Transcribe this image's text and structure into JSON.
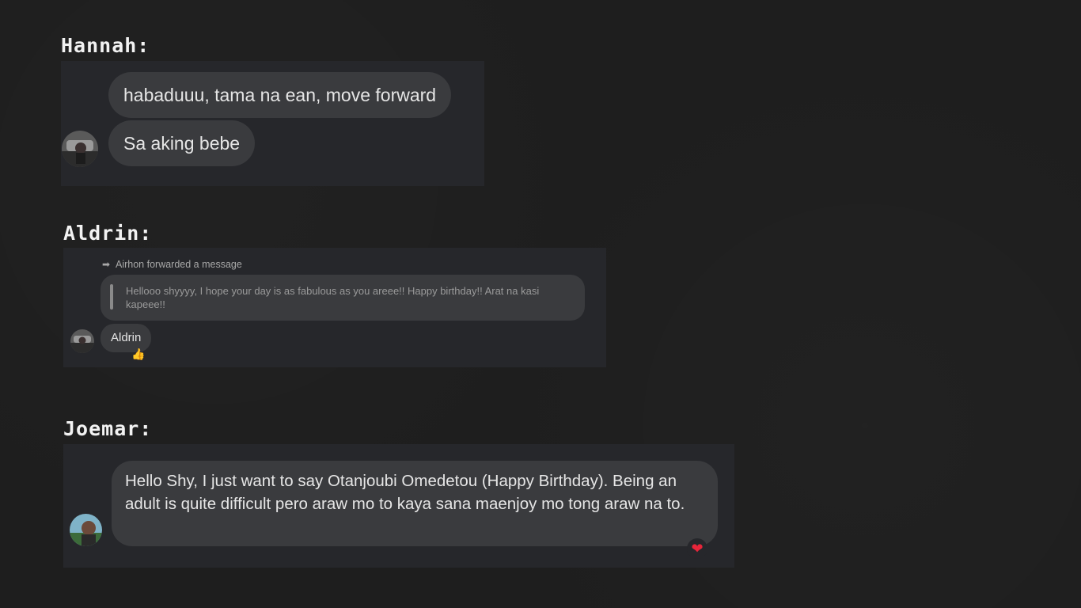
{
  "hannah": {
    "name": "Hannah:",
    "messages": [
      "habaduuu, tama na ean, move forward",
      "Sa aking bebe"
    ]
  },
  "aldrin": {
    "name": "Aldrin:",
    "forwarded_label": "Airhon forwarded a message",
    "quoted_text": "Hellooo shyyyy, I hope your day is as fabulous as you areee!! Happy birthday!! Arat na kasi kapeee!!",
    "reply": "Aldrin",
    "reaction": "👍"
  },
  "joemar": {
    "name": "Joemar:",
    "message": "Hello Shy, I just want to say Otanjoubi Omedetou (Happy Birthday). Being an adult  is quite difficult pero araw mo to kaya sana maenjoy mo tong araw na to.",
    "reaction": "❤"
  },
  "colors": {
    "background": "#1e1e1e",
    "panel": "#26272b",
    "bubble": "#3a3b3e",
    "heart": "#e8253a"
  }
}
